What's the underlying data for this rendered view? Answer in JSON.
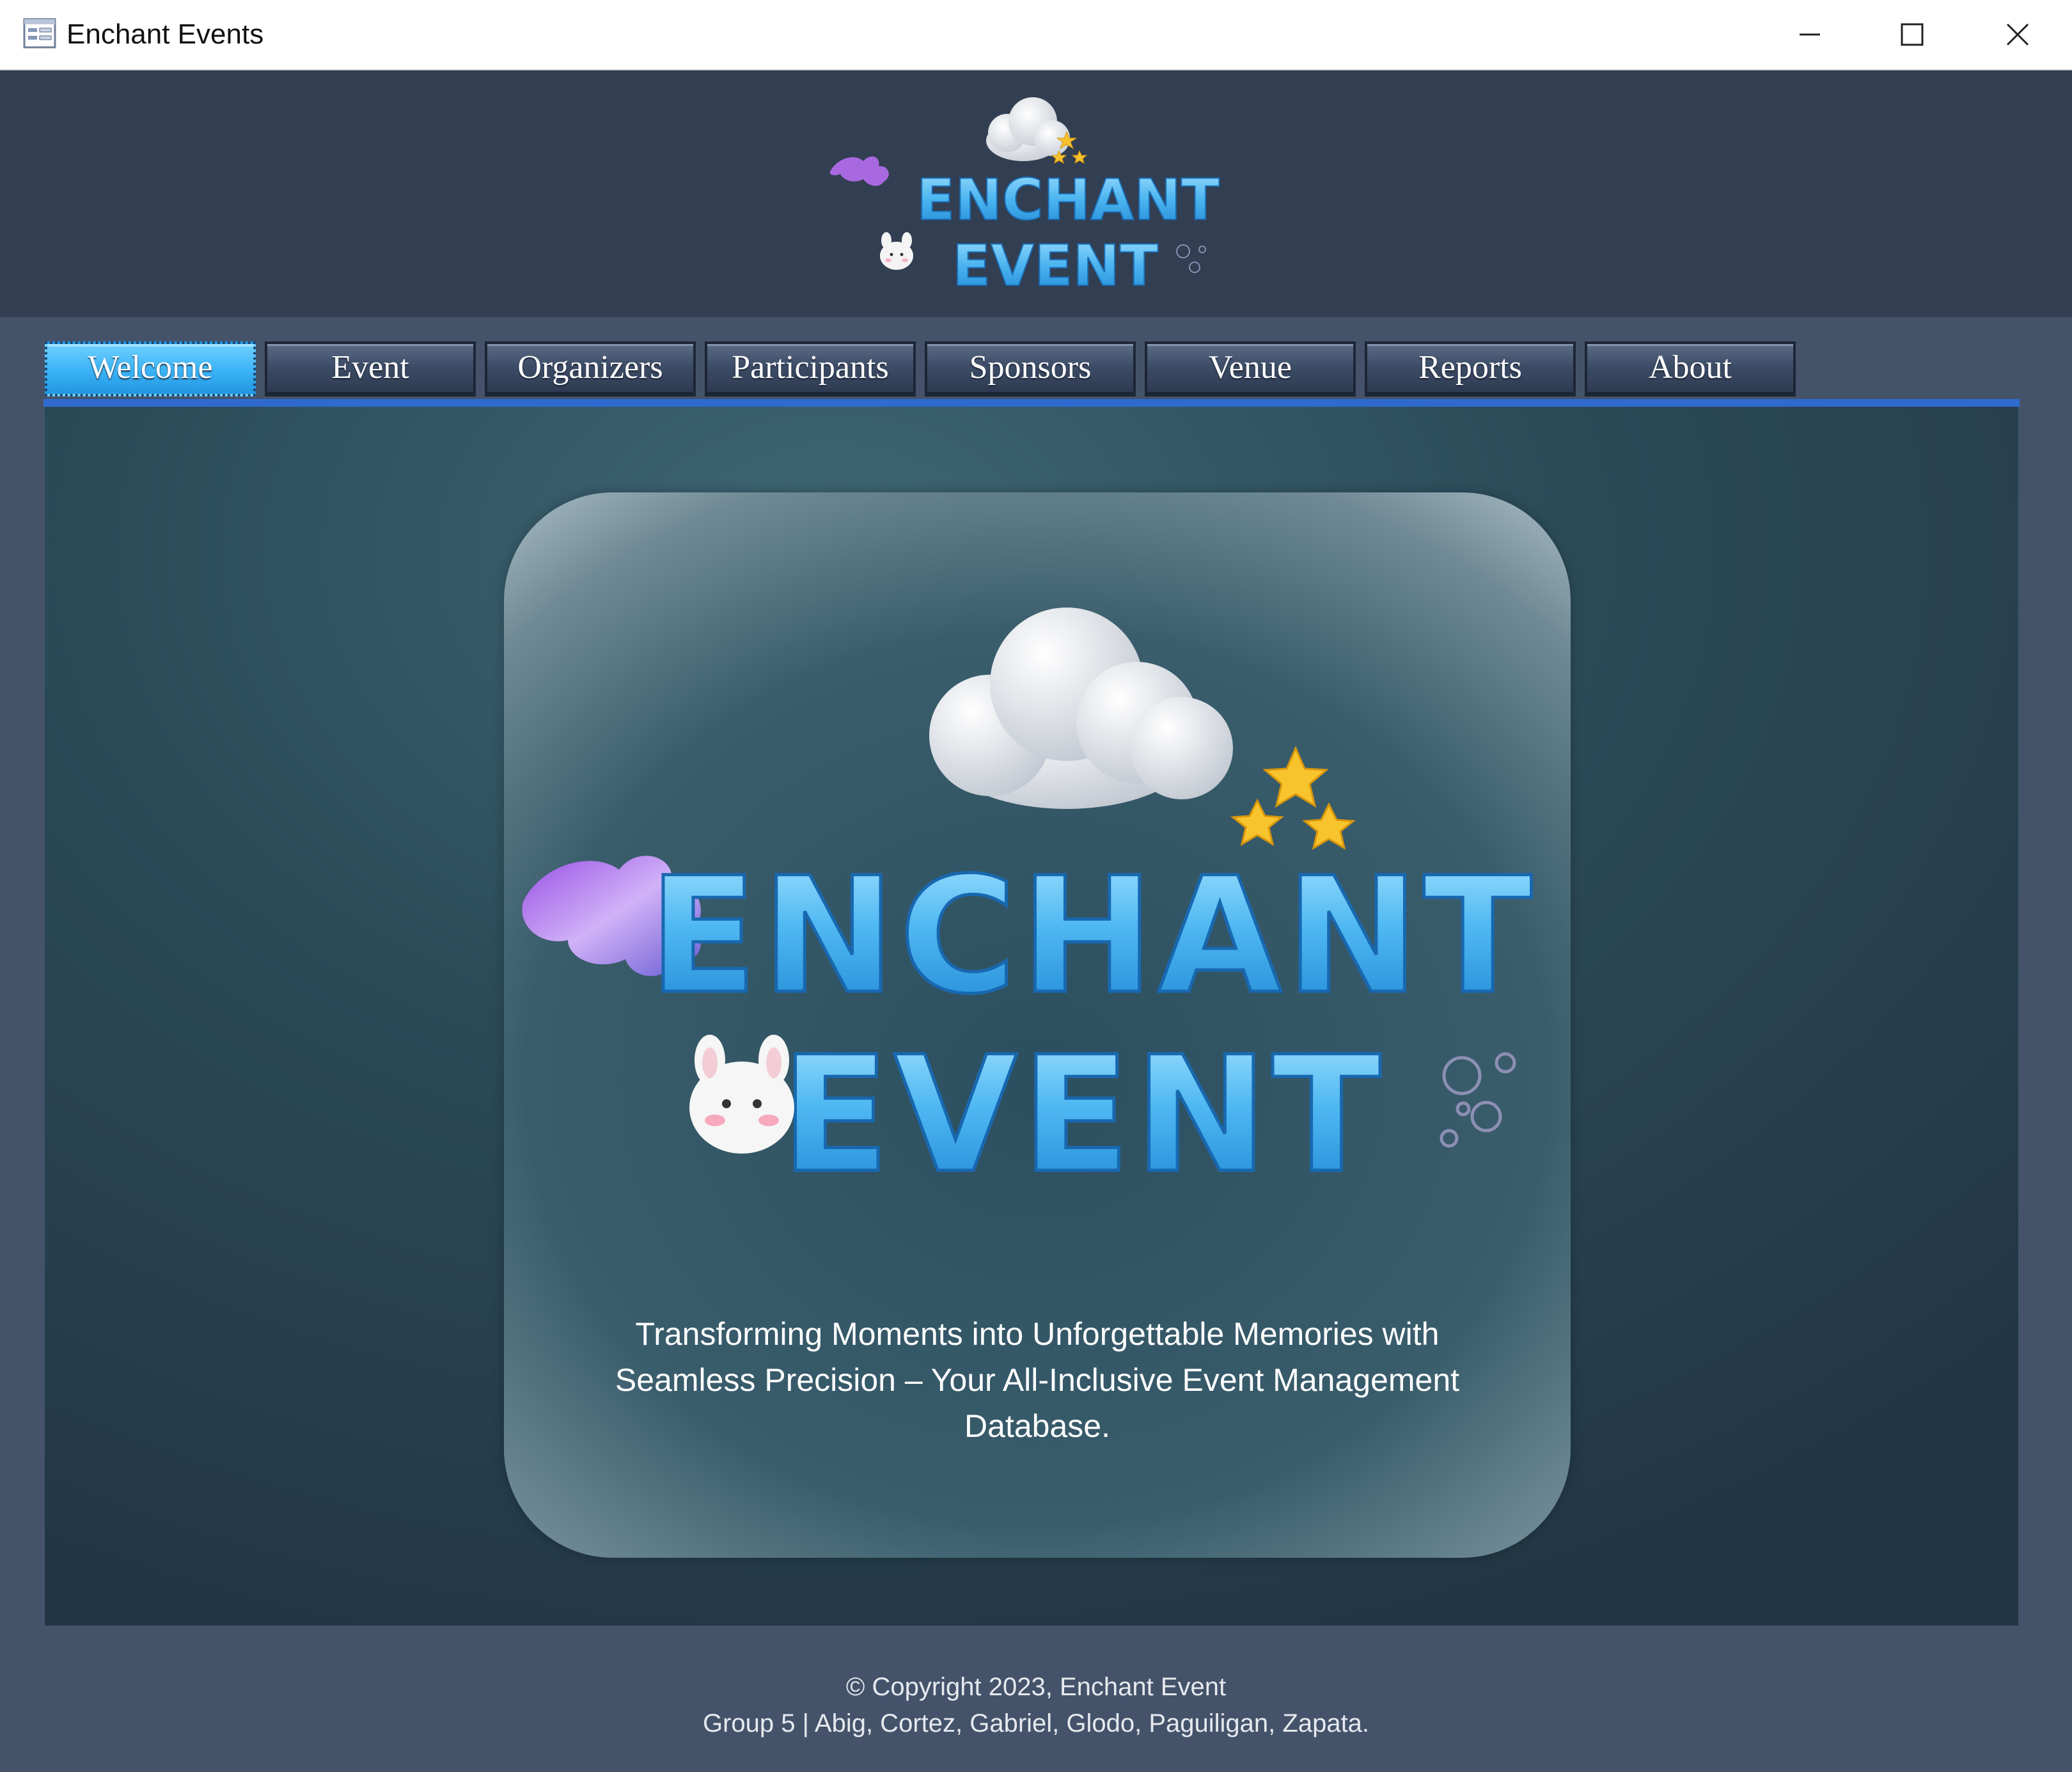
{
  "window": {
    "title": "Enchant Events",
    "controls": {
      "minimize": "minimize",
      "maximize": "maximize",
      "close": "close"
    }
  },
  "header": {
    "logo_line1": "ENCHANT",
    "logo_line2": "EVENT"
  },
  "nav": {
    "tabs": [
      {
        "label": "Welcome",
        "active": true
      },
      {
        "label": "Event",
        "active": false
      },
      {
        "label": "Organizers",
        "active": false
      },
      {
        "label": "Participants",
        "active": false
      },
      {
        "label": "Sponsors",
        "active": false
      },
      {
        "label": "Venue",
        "active": false
      },
      {
        "label": "Reports",
        "active": false
      },
      {
        "label": "About",
        "active": false
      }
    ]
  },
  "welcome": {
    "logo_line1": "ENCHANT",
    "logo_line2": "EVENT",
    "tagline": "Transforming Moments into Unforgettable Memories with Seamless Precision – Your All-Inclusive Event Management Database."
  },
  "footer": {
    "copyright": "© Copyright 2023, Enchant Event",
    "credits": "Group 5 | Abig, Cortez, Gabriel, Glodo, Paguiligan, Zapata."
  },
  "colors": {
    "titlebar": "#ffffff",
    "header_bg": "#323e52",
    "page_bg": "#44536a",
    "active_tab": "#3ab2f5",
    "tab_underline": "#2f6ad0",
    "logo_blue": "#4bb4ef"
  }
}
